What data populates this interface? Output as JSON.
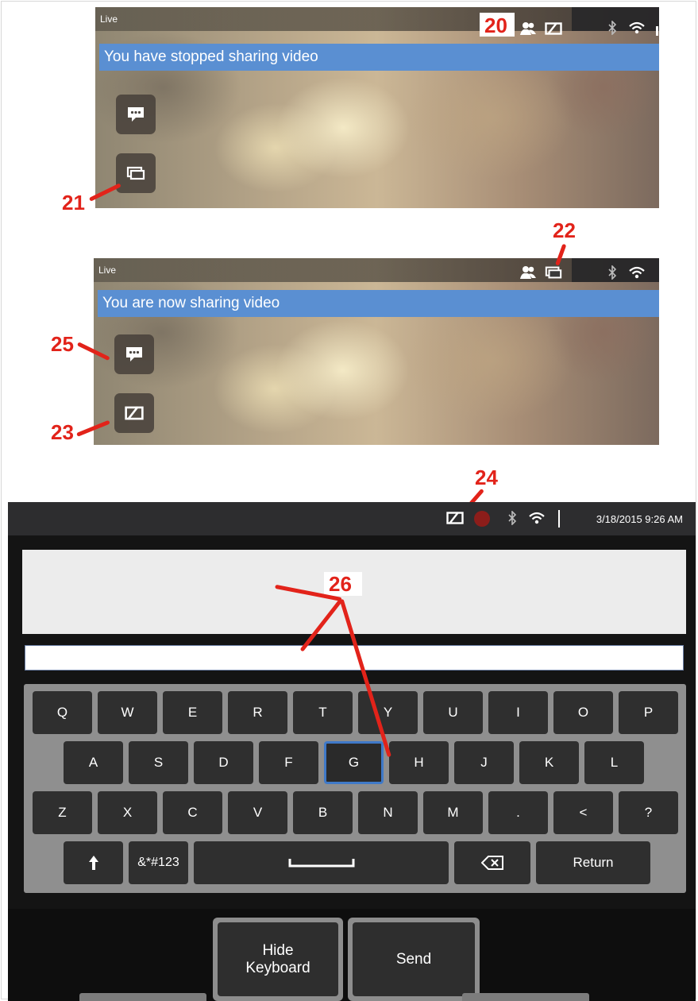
{
  "panel_top": {
    "mode_label": "Live",
    "banner_text": "You have stopped sharing video",
    "status_icons": [
      "contacts-icon",
      "video-share-stopped-icon",
      "bluetooth-icon",
      "wifi-icon"
    ],
    "side_buttons": [
      "chat-icon",
      "share-video-icon"
    ]
  },
  "panel_middle": {
    "mode_label": "Live",
    "banner_text": "You are now sharing video",
    "status_icons": [
      "contacts-icon",
      "video-sharing-icon",
      "bluetooth-icon",
      "wifi-icon"
    ],
    "side_buttons": [
      "chat-icon",
      "stop-share-video-icon"
    ]
  },
  "callouts": {
    "c20": "20",
    "c21": "21",
    "c22": "22",
    "c23": "23",
    "c24": "24",
    "c25": "25",
    "c26": "26"
  },
  "device": {
    "datetime": "3/18/2015  9:26 AM",
    "status_icons": [
      "video-share-stopped-icon",
      "record-indicator-icon",
      "bluetooth-icon",
      "wifi-icon"
    ],
    "message_input_value": "",
    "keyboard": {
      "row1": [
        "Q",
        "W",
        "E",
        "R",
        "T",
        "Y",
        "U",
        "I",
        "O",
        "P"
      ],
      "row2": [
        "A",
        "S",
        "D",
        "F",
        "G",
        "H",
        "J",
        "K",
        "L"
      ],
      "row3": [
        "Z",
        "X",
        "C",
        "V",
        "B",
        "N",
        "M",
        ".",
        "<",
        "?"
      ],
      "row4": {
        "shift": "shift-arrow-icon",
        "symbols": "&*#123",
        "space": "space-bar-icon",
        "backspace": "backspace-icon",
        "return": "Return"
      },
      "selected_key": "G"
    },
    "buttons": {
      "hide_keyboard": "Hide\nKeyboard",
      "send": "Send"
    }
  },
  "colors": {
    "banner": "#5a8fd2",
    "callout": "#e2231a",
    "selected_key_border": "#3f79c8"
  }
}
